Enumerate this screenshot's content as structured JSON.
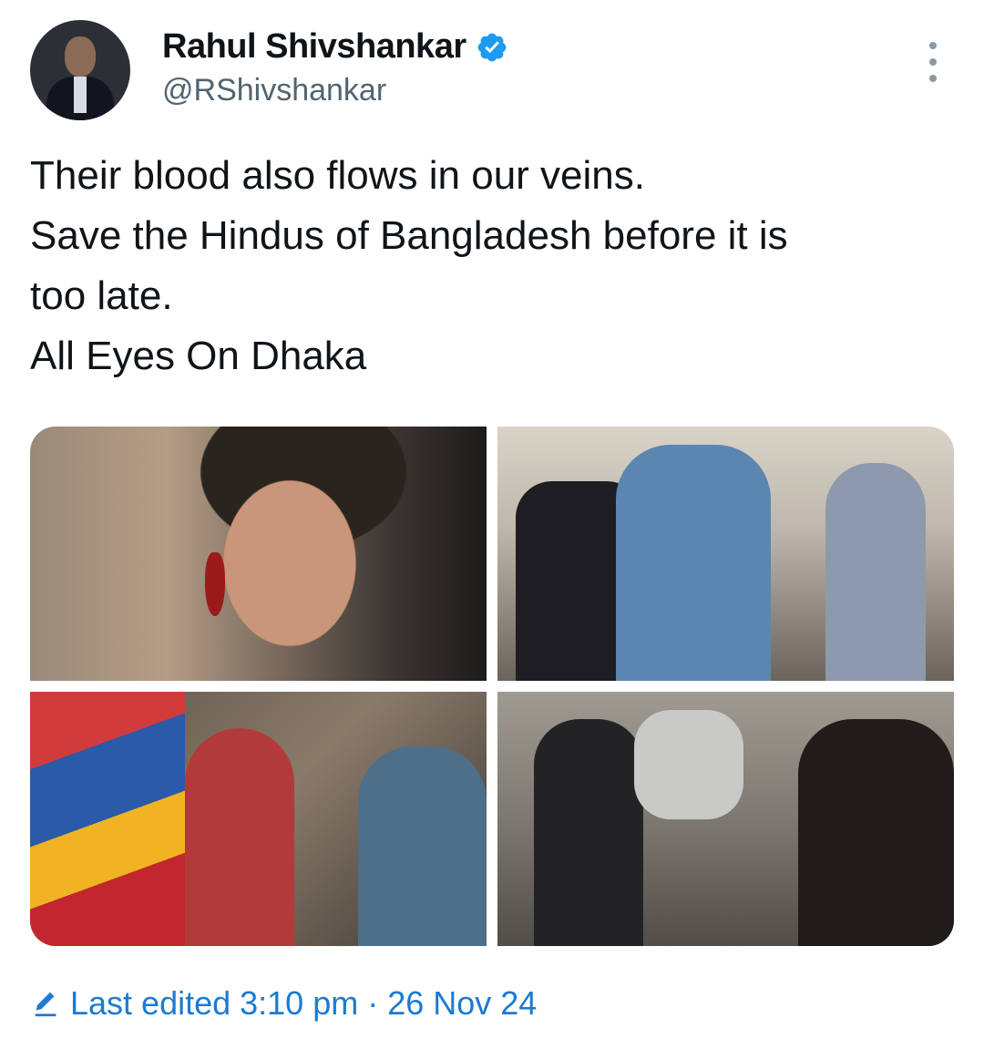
{
  "author": {
    "display_name": "Rahul Shivshankar",
    "handle": "@RShivshankar",
    "verified": true
  },
  "tweet": {
    "lines": [
      "Their blood also flows in our veins.",
      "Save the Hindus of Bangladesh before it is",
      "too late.",
      "All Eyes On Dhaka"
    ]
  },
  "footer": {
    "edited_label": "Last edited",
    "time": "3:10 pm",
    "separator": "·",
    "date": "26 Nov 24"
  },
  "colors": {
    "verified_blue": "#1d9bf0",
    "link_blue": "#1d7ad0",
    "text_secondary": "#536471"
  },
  "icons": {
    "verified": "verified-badge-icon",
    "more": "more-options-icon",
    "edit": "pencil-edit-icon"
  }
}
